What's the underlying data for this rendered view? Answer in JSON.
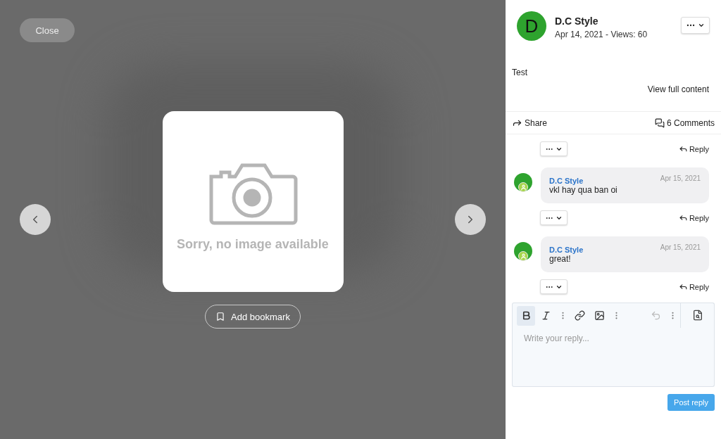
{
  "viewer": {
    "close": "Close",
    "image_message": "Sorry, no image available",
    "bookmark": "Add bookmark"
  },
  "post": {
    "author": "D.C Style",
    "initial": "D",
    "meta": "Apr 14, 2021 - Views: 60",
    "body": "Test",
    "view_full": "View full content",
    "share": "Share",
    "comments_count": "6 Comments"
  },
  "top_reply": "Reply",
  "comments": [
    {
      "author": "D.C Style",
      "date": "Apr 15, 2021",
      "text": "vkl hay qua ban oi",
      "reply": "Reply"
    },
    {
      "author": "D.C Style",
      "date": "Apr 15, 2021",
      "text": "great!",
      "reply": "Reply"
    }
  ],
  "editor": {
    "tools": [
      {
        "kind": "bold",
        "active": true,
        "disabled": false
      },
      {
        "kind": "italic",
        "active": false,
        "disabled": false
      },
      {
        "kind": "more",
        "active": false,
        "disabled": false
      },
      {
        "kind": "link",
        "active": false,
        "disabled": false
      },
      {
        "kind": "image",
        "active": false,
        "disabled": false
      },
      {
        "kind": "more",
        "active": false,
        "disabled": false
      },
      {
        "kind": "undo",
        "active": false,
        "disabled": true
      },
      {
        "kind": "more",
        "active": false,
        "disabled": false
      }
    ],
    "placeholder": "Write your reply...",
    "submit": "Post reply"
  }
}
